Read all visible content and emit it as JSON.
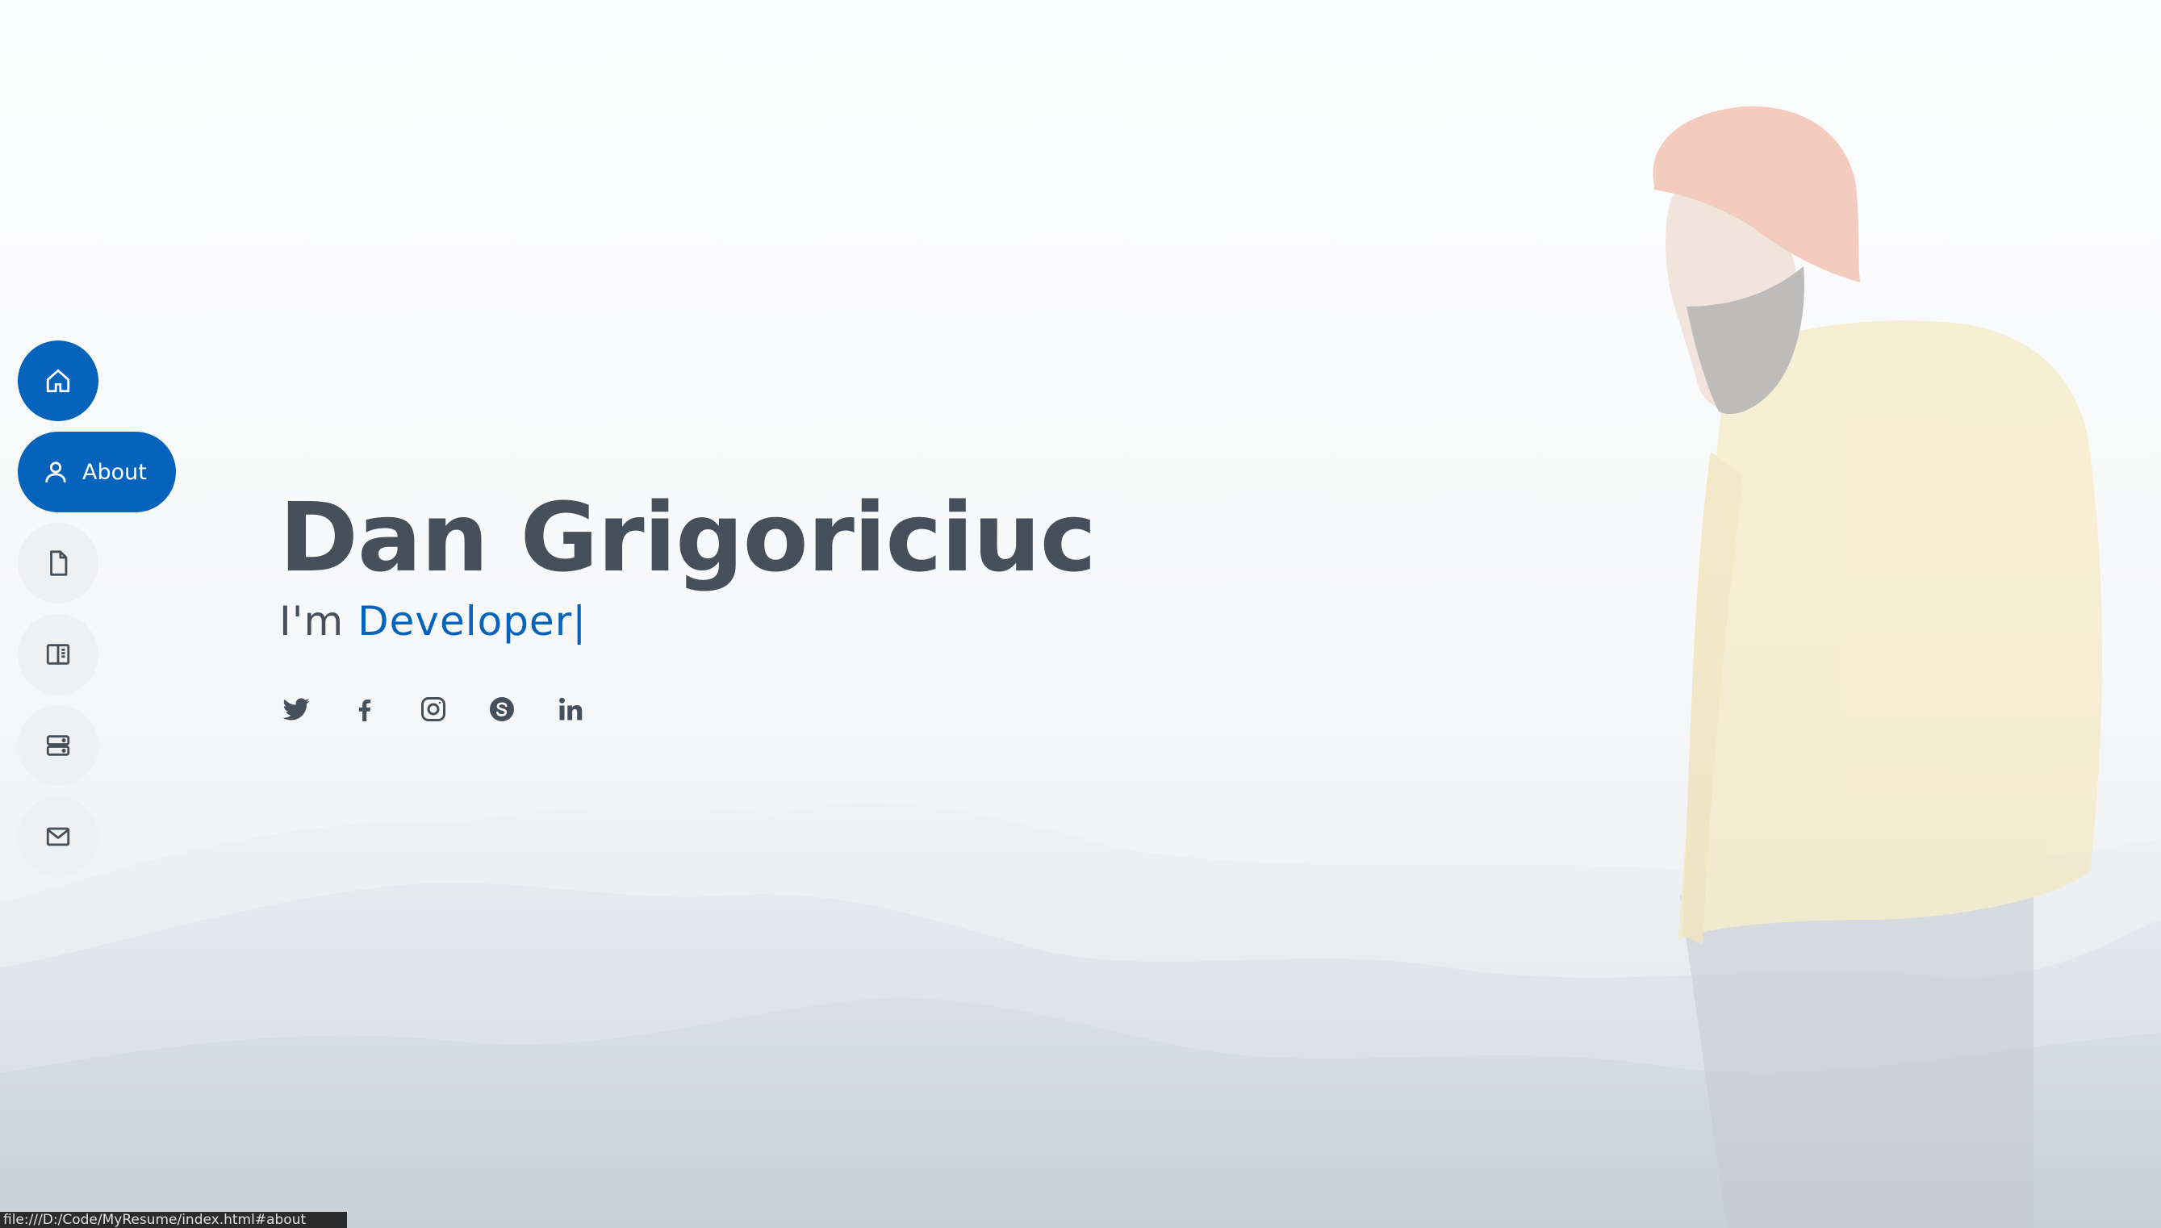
{
  "nav": {
    "items": [
      {
        "icon": "home-icon",
        "label": "",
        "active": true
      },
      {
        "icon": "person-icon",
        "label": "About",
        "active": true
      },
      {
        "icon": "file-icon",
        "label": ""
      },
      {
        "icon": "book-icon",
        "label": ""
      },
      {
        "icon": "server-icon",
        "label": ""
      },
      {
        "icon": "envelope-icon",
        "label": ""
      }
    ]
  },
  "hero": {
    "name": "Dan Grigoriciuc",
    "prefix": "I'm ",
    "role": "Developer",
    "cursor": "|"
  },
  "social": [
    "twitter-icon",
    "facebook-icon",
    "instagram-icon",
    "skype-icon",
    "linkedin-icon"
  ],
  "status_bar": {
    "url": "file:///D:/Code/MyResume/index.html#about"
  },
  "colors": {
    "accent": "#0563bb",
    "text": "#45505b",
    "nav_idle": "#eef0f2"
  }
}
